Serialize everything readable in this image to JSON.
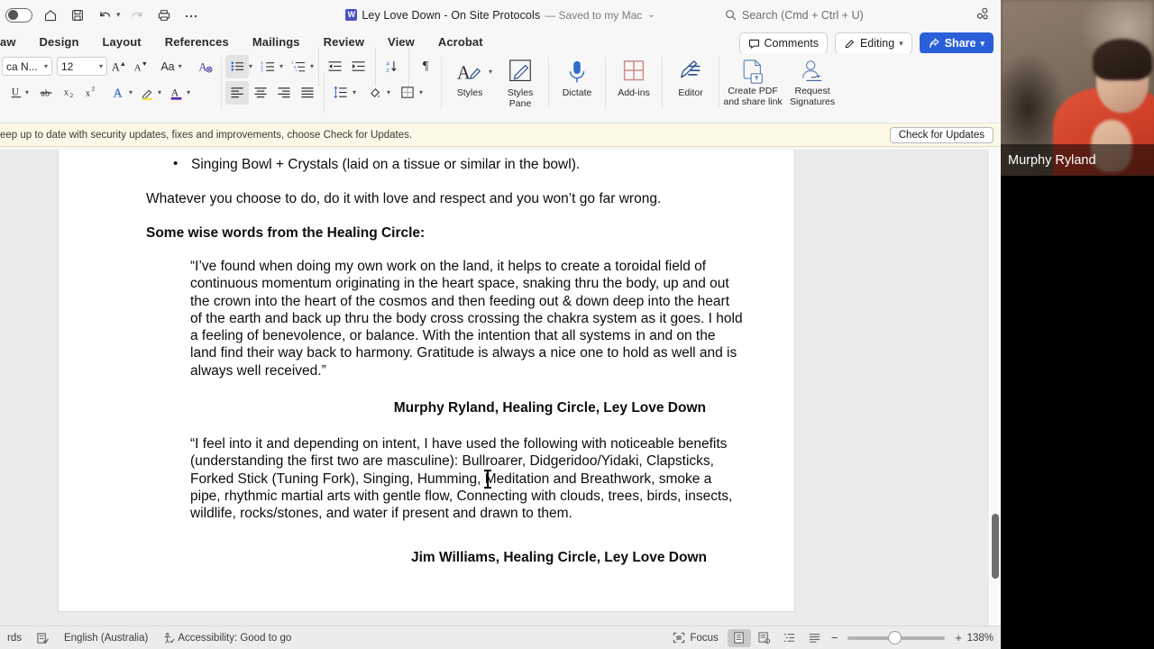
{
  "app": {
    "document_title": "Ley Love Down - On Site Protocols",
    "save_state": "— Saved to my Mac",
    "title_icon": "word-document-icon"
  },
  "quick_access": {
    "items": [
      {
        "name": "ribbon-display-toggle",
        "icon": "toggle-switch-icon"
      },
      {
        "name": "home-button",
        "icon": "home-icon"
      },
      {
        "name": "save-button",
        "icon": "save-disk-icon"
      },
      {
        "name": "undo-button",
        "icon": "undo-arrow-icon"
      },
      {
        "name": "undo-dropdown",
        "icon": "chevron-down-icon"
      },
      {
        "name": "redo-button",
        "icon": "redo-arrow-icon"
      },
      {
        "name": "print-button",
        "icon": "printer-icon"
      },
      {
        "name": "more-commands-button",
        "icon": "ellipsis-icon"
      }
    ]
  },
  "search": {
    "placeholder": "Search (Cmd + Ctrl + U)",
    "icon": "search-icon",
    "collab_icon": "collaborators-icon"
  },
  "ribbon_tabs": [
    {
      "label": "aw",
      "name": "tab-draw"
    },
    {
      "label": "Design",
      "name": "tab-design"
    },
    {
      "label": "Layout",
      "name": "tab-layout"
    },
    {
      "label": "References",
      "name": "tab-references"
    },
    {
      "label": "Mailings",
      "name": "tab-mailings"
    },
    {
      "label": "Review",
      "name": "tab-review"
    },
    {
      "label": "View",
      "name": "tab-view"
    },
    {
      "label": "Acrobat",
      "name": "tab-acrobat"
    }
  ],
  "ribbon_right_buttons": [
    {
      "label": "Comments",
      "name": "comments-button",
      "icon": "comment-bubble-icon"
    },
    {
      "label": "Editing",
      "name": "editing-mode-button",
      "icon": "pencil-icon"
    },
    {
      "label": "Share",
      "name": "share-button",
      "icon": "share-icon"
    }
  ],
  "font_controls": {
    "font_name": "ca N...",
    "font_size": "12",
    "grow_font": "A",
    "shrink_font": "A",
    "change_case": "Aa",
    "clear_formatting_icon": "clear-formatting-icon"
  },
  "ribbon_groups": [
    {
      "name": "styles-group",
      "buttons": [
        {
          "label": "Styles",
          "name": "styles-button",
          "icon": "styles-pen-icon"
        },
        {
          "label": "Styles\nPane",
          "name": "styles-pane-button",
          "icon": "styles-pane-icon"
        }
      ]
    },
    {
      "name": "dictate-group",
      "buttons": [
        {
          "label": "Dictate",
          "name": "dictate-button",
          "icon": "microphone-icon"
        }
      ]
    },
    {
      "name": "addins-group",
      "buttons": [
        {
          "label": "Add-ins",
          "name": "add-ins-button",
          "icon": "addins-grid-icon"
        }
      ]
    },
    {
      "name": "editor-group",
      "buttons": [
        {
          "label": "Editor",
          "name": "editor-button",
          "icon": "editor-pencil-icon"
        }
      ]
    },
    {
      "name": "acrobat-group",
      "buttons": [
        {
          "label": "Create PDF\nand share link",
          "name": "create-pdf-button",
          "icon": "pdf-upload-icon"
        },
        {
          "label": "Request\nSignatures",
          "name": "request-signatures-button",
          "icon": "signature-person-icon"
        }
      ]
    }
  ],
  "notification": {
    "text": "eep up to date with security updates, fixes and improvements, choose Check for Updates.",
    "button_label": "Check for Updates"
  },
  "document": {
    "bullets": [
      "Singing Bowl + Crystals (laid on a tissue or similar in the bowl)."
    ],
    "paragraph": "Whatever you choose to do, do it with love and respect and you won’t go far wrong.",
    "heading": "Some wise words from the Healing Circle:",
    "quote_one": "“I’ve found when doing my own work on the land, it helps to create a toroidal field of continuous momentum originating in the heart space, snaking thru the body, up and out the crown into the heart of the cosmos and then feeding out & down deep into the heart of the earth and back up thru the body cross crossing the chakra system as it goes.  I hold a feeling of benevolence, or balance. With the intention that all systems in and on the land find their way back to harmony. Gratitude is always a nice one to hold as well and is always well received.”",
    "attribution_one": "Murphy Ryland, Healing Circle, Ley Love Down",
    "quote_two": "“I feel into it and depending on intent, I have used the following with noticeable benefits (understanding the first two are masculine): Bullroarer, Didgeridoo/Yidaki, Clapsticks, Forked Stick (Tuning Fork), Singing, Humming, Meditation and Breathwork, smoke a pipe, rhythmic martial arts with gentle flow, Connecting with clouds, trees, birds, insects, wildlife, rocks/stones, and water if present and drawn to them.",
    "attribution_two": "Jim Williams, Healing Circle, Ley Love Down"
  },
  "status_bar": {
    "word_count": "rds",
    "proofing_icon": "proofing-check-icon",
    "language": "English (Australia)",
    "accessibility_icon": "accessibility-icon",
    "accessibility": "Accessibility: Good to go",
    "focus_label": "Focus",
    "focus_icon": "focus-frame-icon",
    "views": [
      {
        "name": "print-layout-view-button",
        "icon": "print-layout-icon",
        "active": true
      },
      {
        "name": "web-layout-view-button",
        "icon": "web-layout-icon",
        "active": false
      },
      {
        "name": "outline-view-button",
        "icon": "outline-icon",
        "active": false
      },
      {
        "name": "draft-view-button",
        "icon": "draft-icon",
        "active": false
      }
    ],
    "zoom_out": "−",
    "zoom_in": "+",
    "zoom_level": "138%"
  },
  "video_overlay": {
    "participant_name": "Murphy Ryland"
  },
  "colors": {
    "accent_blue": "#2b5fd9",
    "notification_bg": "#fbf8e6",
    "canvas_gray": "#ebebeb",
    "shirt_red": "#cf3f28"
  }
}
